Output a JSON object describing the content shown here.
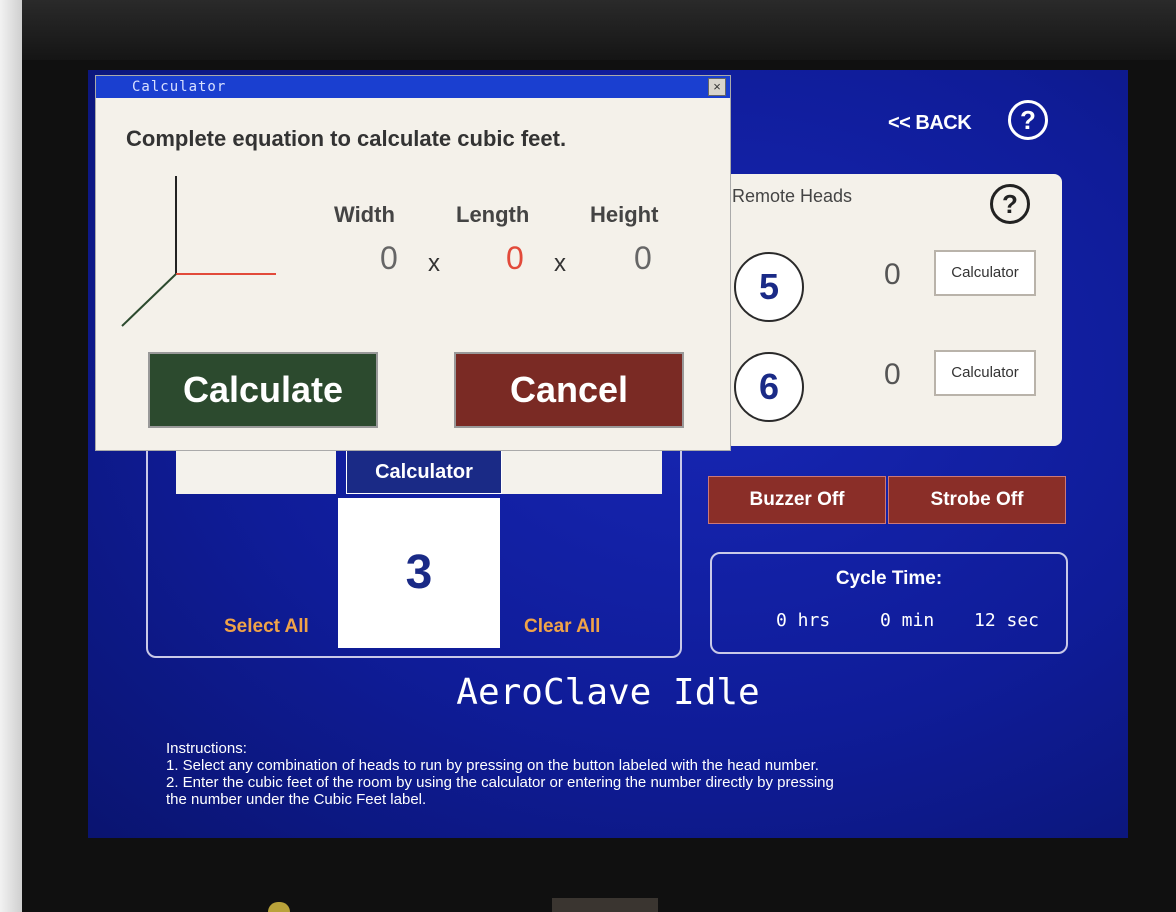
{
  "header": {
    "back_label": "<< BACK",
    "help_label": "?"
  },
  "remote_heads": {
    "title": "Remote Heads",
    "help_label": "?",
    "heads": [
      {
        "number": "5",
        "value": "0",
        "calc_label": "Calculator"
      },
      {
        "number": "6",
        "value": "0",
        "calc_label": "Calculator"
      }
    ]
  },
  "main_panel": {
    "calc_label": "Calculator",
    "cubic_value": "3",
    "select_all": "Select All",
    "clear_all": "Clear All"
  },
  "alarms": {
    "buzzer_label": "Buzzer Off",
    "strobe_label": "Strobe Off"
  },
  "cycle_time": {
    "title": "Cycle Time:",
    "hrs": "0 hrs",
    "min": "0 min",
    "sec": "12 sec"
  },
  "status_text": "AeroClave Idle",
  "instructions": {
    "heading": "Instructions:",
    "line1": "1. Select any combination of heads to run by pressing on the button labeled with the head number.",
    "line2": "2. Enter the cubic feet of the room by using the calculator or entering the number directly by pressing",
    "line3": "the number under the Cubic Feet label."
  },
  "dialog": {
    "title": "Calculator",
    "close_label": "×",
    "prompt": "Complete equation to calculate cubic feet.",
    "labels": {
      "width": "Width",
      "length": "Length",
      "height": "Height"
    },
    "values": {
      "width": "0",
      "length": "0",
      "height": "0"
    },
    "times": "x",
    "calculate_label": "Calculate",
    "cancel_label": "Cancel"
  },
  "colors": {
    "screen_bg": "#0e1a94",
    "calculate_green": "#2c4a2e",
    "cancel_red": "#7a2a24",
    "accent_orange": "#f0a348",
    "length_highlight": "#e24a3a"
  }
}
